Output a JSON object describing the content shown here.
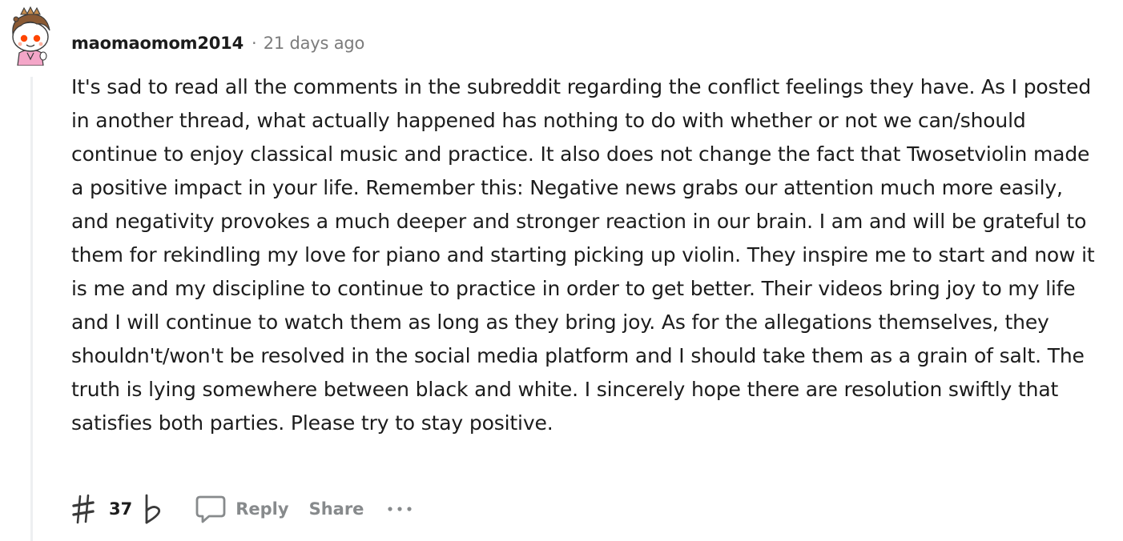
{
  "comment": {
    "author": "maomaomom2014",
    "separator": "·",
    "timestamp": "21 days ago",
    "body": "It's sad to read all the comments in the subreddit regarding the conflict feelings they have. As I posted in another thread, what actually happened has nothing to do with whether or not we can/should continue to enjoy classical music and practice. It also does not change the fact that Twosetviolin made a positive impact in your life. Remember this: Negative news grabs our attention much more easily, and negativity provokes a much deeper and stronger reaction in our brain. I am and will be grateful to them for rekindling my love for piano and starting picking up violin. They inspire me to start and now it is me and my discipline to continue to practice in order to get better. Their videos bring joy to my life and I will continue to watch them as long as they bring joy. As for the allegations themselves, they shouldn't/won't be resolved in the social media platform and I should take them as a grain of salt. The truth is lying somewhere between black and white. I sincerely hope there are resolution swiftly that satisfies both parties. Please try to stay positive.",
    "score": "37"
  },
  "actions": {
    "reply_label": "Reply",
    "share_label": "Share"
  },
  "icons": {
    "upvote": "sharp-upvote-icon",
    "downvote": "flat-downvote-icon",
    "reply": "speech-bubble-icon",
    "more": "ellipsis-icon",
    "avatar": "snoo-avatar"
  },
  "colors": {
    "text": "#1c1c1c",
    "meta": "#7c7c7c",
    "action": "#878a8c",
    "thread_line": "#edeff1",
    "avatar_skin": "#ffffff",
    "avatar_hair": "#8a5a34",
    "avatar_accent": "#ff4500",
    "avatar_shirt": "#f4a6c8"
  }
}
